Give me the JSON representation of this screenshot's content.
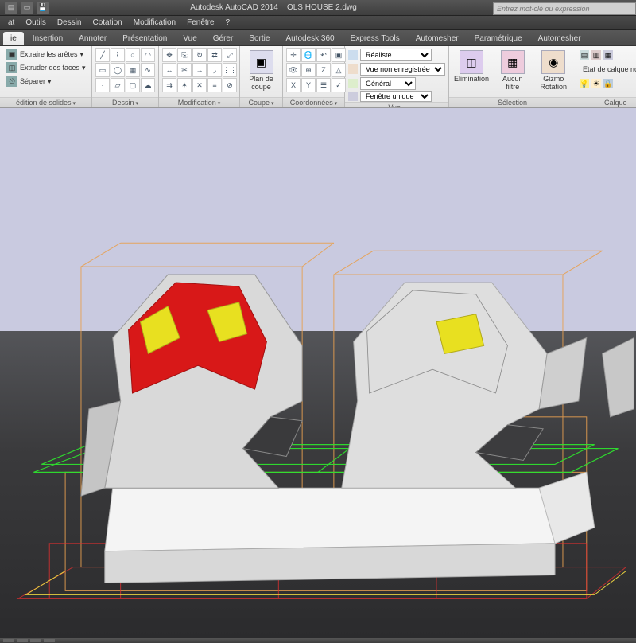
{
  "app": {
    "name": "Autodesk AutoCAD 2014",
    "document": "OLS HOUSE 2.dwg"
  },
  "search": {
    "placeholder": "Entrez mot-clé ou expression"
  },
  "menus": [
    "at",
    "Outils",
    "Dessin",
    "Cotation",
    "Modification",
    "Fenêtre",
    "?"
  ],
  "tabs": [
    "ie",
    "Insertion",
    "Annoter",
    "Présentation",
    "Vue",
    "Gérer",
    "Sortie",
    "Autodesk 360",
    "Express Tools",
    "Automesher",
    "Paramétrique",
    "Automesher"
  ],
  "active_tab": 0,
  "panels": {
    "solids_edit": {
      "title": "édition de solides",
      "items": [
        "Extraire les arêtes",
        "Extruder des faces",
        "Séparer"
      ]
    },
    "dessin": {
      "title": "Dessin"
    },
    "modification": {
      "title": "Modification"
    },
    "coupe": {
      "title": "Coupe",
      "big": "Plan\nde coupe"
    },
    "coords": {
      "title": "Coordonnées"
    },
    "vue": {
      "title": "Vue",
      "rows": [
        {
          "value": "Réaliste"
        },
        {
          "value": "Vue non enregistrée"
        },
        {
          "value": "Général"
        },
        {
          "value": "Fenêtre unique"
        }
      ]
    },
    "selection": {
      "title": "Sélection",
      "items": [
        "Elimination",
        "Aucun filtre",
        "Gizmo Rotation"
      ]
    },
    "calques": {
      "title": "Calque",
      "label": "Etat de calque non e"
    }
  },
  "statusbar": {
    "coords": ""
  }
}
